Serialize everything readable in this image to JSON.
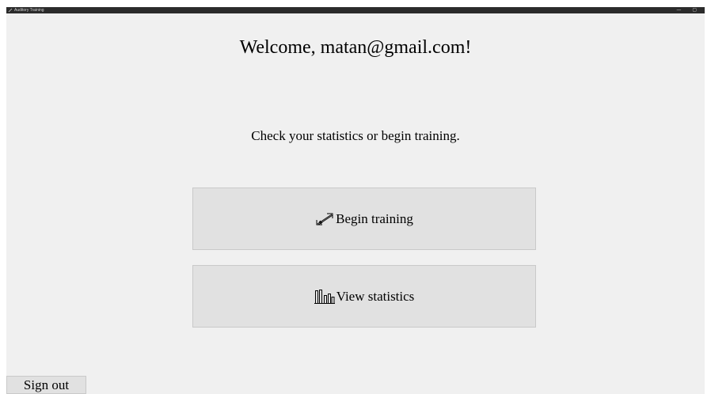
{
  "window": {
    "title": "Auditory Training",
    "controls": {
      "minimize": "—",
      "restore": "▢"
    }
  },
  "main": {
    "welcome": "Welcome, matan@gmail.com!",
    "subtitle": "Check your statistics or begin training.",
    "begin_training_label": "Begin training",
    "view_statistics_label": "View statistics",
    "sign_out_label": "Sign out",
    "icons": {
      "begin_training": "expand-arrows-icon",
      "view_statistics": "bar-chart-icon"
    }
  },
  "colors": {
    "background": "#f0f0f0",
    "button": "#e1e1e1",
    "titlebar": "#2b2b2b"
  }
}
